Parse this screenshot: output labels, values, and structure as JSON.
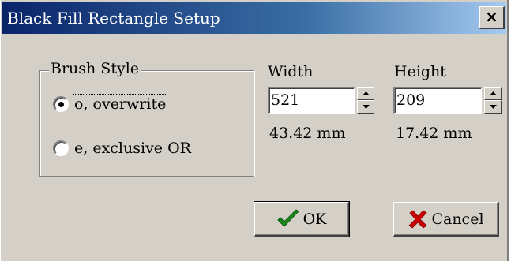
{
  "window": {
    "title": "Black Fill Rectangle Setup",
    "close_glyph": "×"
  },
  "brush_style": {
    "group_label": "Brush Style",
    "options": [
      {
        "label": "o, overwrite",
        "selected": true
      },
      {
        "label": "e, exclusive OR",
        "selected": false
      }
    ]
  },
  "width": {
    "label": "Width",
    "value": "521",
    "mm": "43.42 mm"
  },
  "height": {
    "label": "Height",
    "value": "209",
    "mm": "17.42 mm"
  },
  "buttons": {
    "ok_label": "OK",
    "ok_icon": "checkmark-icon",
    "cancel_label": "Cancel",
    "cancel_icon": "x-cross-icon"
  },
  "colors": {
    "title_start": "#0a246a",
    "title_end": "#a6caf0",
    "dialog_bg": "#d4d0c8",
    "ok_check": "#1a8a1a",
    "cancel_x": "#cc0000"
  }
}
